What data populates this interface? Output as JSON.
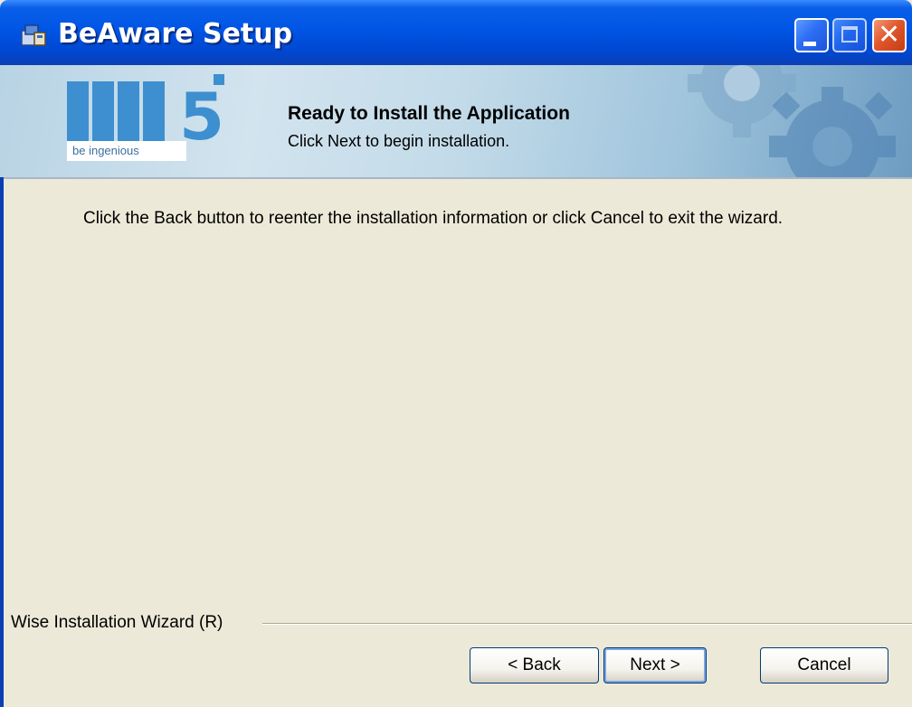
{
  "window": {
    "title": "BeAware Setup",
    "icon": "setup-installer-icon",
    "controls": [
      "minimize-icon",
      "maximize-icon",
      "close-icon"
    ]
  },
  "banner": {
    "logo_tagline": "be ingenious",
    "title": "Ready to Install the Application",
    "subtitle": "Click Next to begin installation."
  },
  "body": {
    "message": "Click the Back button to reenter the installation information or click Cancel to exit the wizard."
  },
  "footer": {
    "brand_label": "Wise Installation Wizard (R)"
  },
  "buttons": {
    "back": "< Back",
    "next": "Next >",
    "cancel": "Cancel"
  },
  "colors": {
    "titlebar": "#0055e5",
    "dialog_bg": "#ece9d8",
    "logo_blue": "#3d8fd0",
    "close_red": "#e2572c"
  }
}
